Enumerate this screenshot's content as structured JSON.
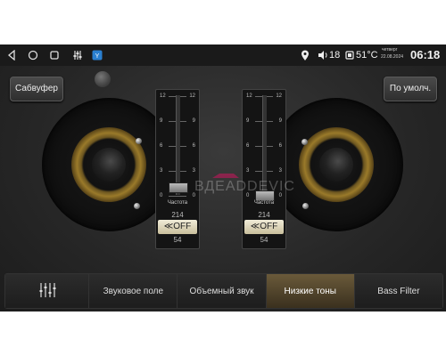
{
  "status_bar": {
    "icons": [
      "back-icon",
      "home-icon",
      "recents-icon",
      "equalizer-icon",
      "app-icon",
      "location-icon",
      "volume-icon",
      "temperature-icon"
    ],
    "volume": "18",
    "temperature": "51°C",
    "weekday": "четверг",
    "date": "22.08.2024",
    "time": "06:18"
  },
  "buttons": {
    "subwoofer": "Сабвуфер",
    "default": "По умолч."
  },
  "sliders": [
    {
      "scale_labels": [
        "12",
        "9",
        "6",
        "3",
        "0"
      ],
      "level": 1,
      "freq_label": "Частота",
      "freq_prev": "214",
      "freq_value": "OFF",
      "freq_next": "54"
    },
    {
      "scale_labels": [
        "12",
        "9",
        "6",
        "3",
        "0"
      ],
      "level": 0,
      "freq_label": "Частота",
      "freq_prev": "214",
      "freq_value": "OFF",
      "freq_next": "54"
    }
  ],
  "watermark": "ВДЕADDEVICE",
  "tabs": [
    {
      "label": "",
      "icon": "equalizer-sliders-icon",
      "active": false
    },
    {
      "label": "Звуковое поле",
      "active": false
    },
    {
      "label": "Объемный звук",
      "active": false
    },
    {
      "label": "Низкие тоны",
      "active": true
    },
    {
      "label": "Bass Filter",
      "active": false
    }
  ],
  "colors": {
    "accent_active_tab": "#6a5a3a",
    "freq_box": "#f0ebd8",
    "speaker_ring": "#9a7a2a"
  }
}
